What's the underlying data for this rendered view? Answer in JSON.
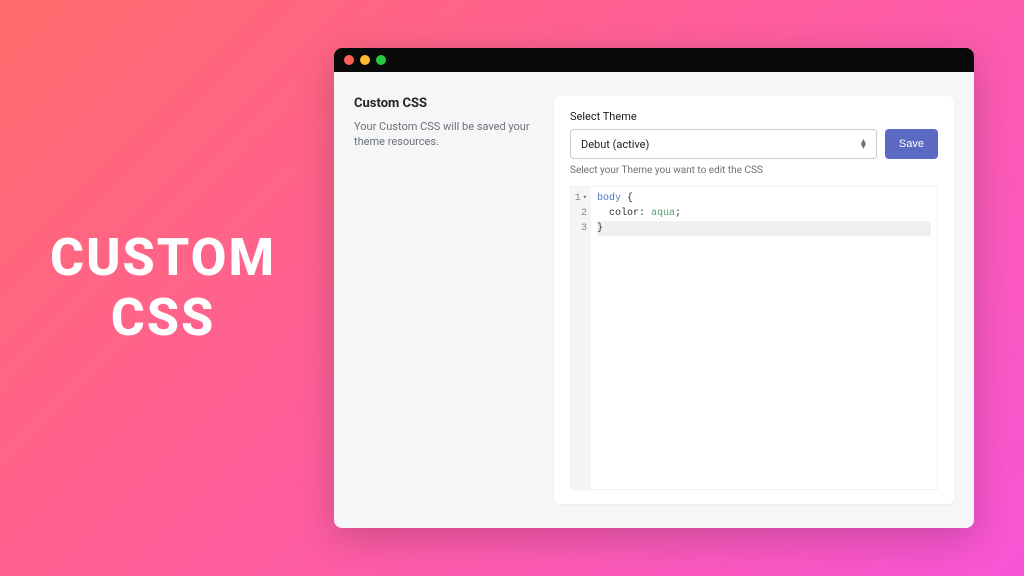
{
  "hero": {
    "line1": "CUSTOM",
    "line2": "CSS"
  },
  "window": {
    "left": {
      "title": "Custom CSS",
      "description": "Your Custom CSS will be saved your theme resources."
    },
    "right": {
      "theme_label": "Select Theme",
      "theme_selected": "Debut (active)",
      "save_label": "Save",
      "helper": "Select your Theme you want to edit the CSS",
      "code": {
        "lines": [
          {
            "num": "1",
            "fold": true,
            "active": false,
            "parts": [
              {
                "cls": "tok-selector",
                "t": "body"
              },
              {
                "cls": "",
                "t": " {"
              }
            ]
          },
          {
            "num": "2",
            "fold": false,
            "active": false,
            "parts": [
              {
                "cls": "",
                "t": "  "
              },
              {
                "cls": "tok-prop",
                "t": "color"
              },
              {
                "cls": "",
                "t": ": "
              },
              {
                "cls": "tok-value",
                "t": "aqua"
              },
              {
                "cls": "",
                "t": ";"
              }
            ]
          },
          {
            "num": "3",
            "fold": false,
            "active": true,
            "parts": [
              {
                "cls": "",
                "t": "}"
              }
            ]
          }
        ]
      }
    }
  }
}
